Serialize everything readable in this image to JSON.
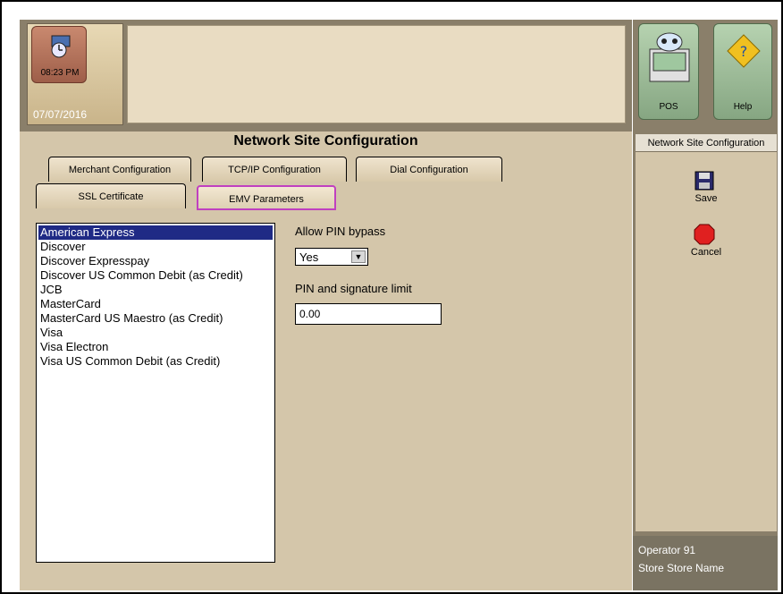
{
  "header": {
    "time": "08:23 PM",
    "date": "07/07/2016",
    "pos_label": "POS",
    "help_label": "Help"
  },
  "title": "Network Site Configuration",
  "tabs": [
    {
      "label": "Merchant Configuration",
      "active": false
    },
    {
      "label": "TCP/IP Configuration",
      "active": false
    },
    {
      "label": "Dial Configuration",
      "active": false
    },
    {
      "label": "SSL Certificate",
      "active": false
    },
    {
      "label": "EMV Parameters",
      "active": true
    }
  ],
  "card_list": {
    "items": [
      "American Express",
      "Discover",
      "Discover Expresspay",
      "Discover US Common Debit (as Credit)",
      "JCB",
      "MasterCard",
      "MasterCard US Maestro (as Credit)",
      "Visa",
      "Visa Electron",
      "Visa US Common Debit (as Credit)"
    ],
    "selected_index": 0
  },
  "form": {
    "pin_bypass_label": "Allow PIN bypass",
    "pin_bypass_value": "Yes",
    "limit_label": "PIN and signature limit",
    "limit_value": "0.00"
  },
  "sidebar": {
    "title": "Network Site Configuration",
    "save_label": "Save",
    "cancel_label": "Cancel",
    "operator": "Operator 91",
    "store": "Store Store Name"
  },
  "icons": [
    "clock-icon",
    "pos-icon",
    "help-icon",
    "save-icon",
    "stop-icon"
  ]
}
